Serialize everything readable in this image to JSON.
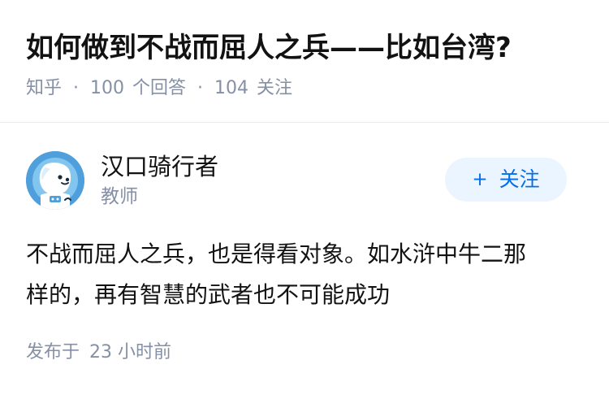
{
  "question": {
    "title": "如何做到不战而屈人之兵——比如台湾?",
    "source": "知乎",
    "separator": "·",
    "answer_count": "100",
    "answer_label": "个回答",
    "follower_count": "104",
    "follower_label": "关注"
  },
  "answer": {
    "author": {
      "name": "汉口骑行者",
      "headline": "教师",
      "avatar_icon": "dog-astronaut-avatar-icon"
    },
    "follow_button": {
      "icon": "plus-icon",
      "icon_glyph": "+",
      "label": "关注"
    },
    "content_lines": [
      "不战而屈人之兵，也是得看对象。如水浒中牛二那",
      "样的，再有智慧的武者也不可能成功"
    ],
    "publish_label": "发布于",
    "publish_time": "23 小时前"
  },
  "colors": {
    "text_primary": "#121212",
    "text_secondary": "#8590a6",
    "accent": "#056de8",
    "button_background": "#ebf5ff",
    "divider": "#ebebeb",
    "avatar_background": "#4f9fdd"
  }
}
